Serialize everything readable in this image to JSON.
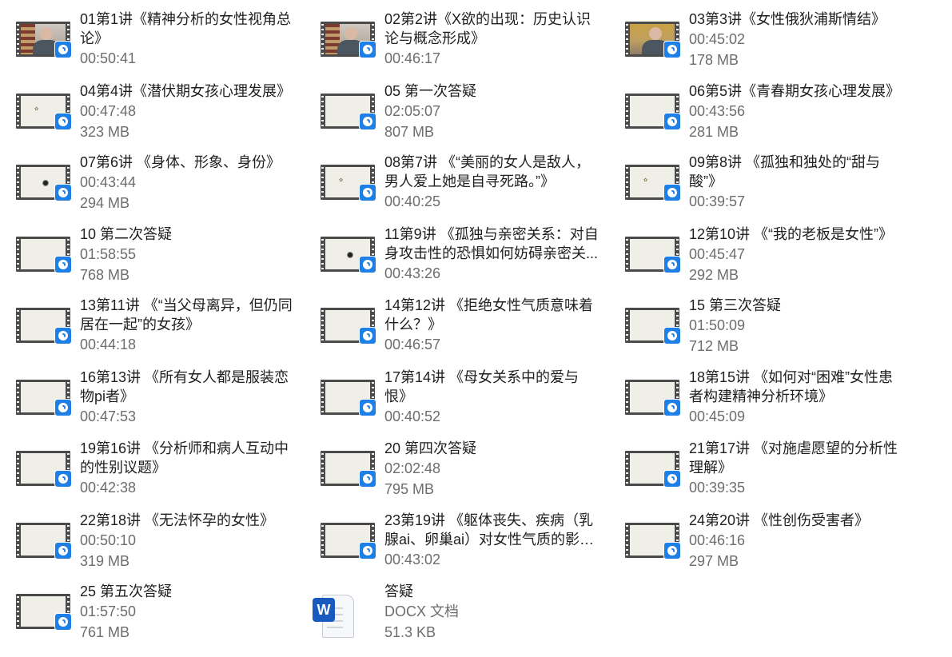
{
  "items": [
    {
      "title": "01第1讲《精神分析的女性视角总论》",
      "duration": "00:50:41",
      "size": "",
      "thumb": "photo-shelf",
      "icon": "video-file-icon"
    },
    {
      "title": "02第2讲《X欲的出现：历史认识论与概念形成》",
      "duration": "00:46:17",
      "size": "",
      "thumb": "photo-shelf",
      "icon": "video-file-icon"
    },
    {
      "title": "03第3讲《女性俄狄浦斯情结》",
      "duration": "00:45:02",
      "size": "178 MB",
      "thumb": "photo-gold",
      "icon": "video-file-icon"
    },
    {
      "title": "04第4讲《潜伏期女孩心理发展》",
      "duration": "00:47:48",
      "size": "323 MB",
      "thumb": "logo",
      "icon": "video-file-icon"
    },
    {
      "title": "05 第一次答疑",
      "duration": "02:05:07",
      "size": "807 MB",
      "thumb": "blank",
      "icon": "video-file-icon"
    },
    {
      "title": "06第5讲《青春期女孩心理发展》",
      "duration": "00:43:56",
      "size": "281 MB",
      "thumb": "blank",
      "icon": "video-file-icon"
    },
    {
      "title": "07第6讲 《身体、形象、身份》",
      "duration": "00:43:44",
      "size": "294 MB",
      "thumb": "dot",
      "icon": "video-file-icon"
    },
    {
      "title": "08第7讲 《“美丽的女人是敌人，男人爱上她是自寻死路。”》",
      "duration": "00:40:25",
      "size": "",
      "thumb": "logo",
      "icon": "video-file-icon"
    },
    {
      "title": "09第8讲 《孤独和独处的“甜与酸”》",
      "duration": "00:39:57",
      "size": "",
      "thumb": "logo",
      "icon": "video-file-icon"
    },
    {
      "title": "10 第二次答疑",
      "duration": "01:58:55",
      "size": "768 MB",
      "thumb": "blank",
      "icon": "video-file-icon"
    },
    {
      "title": "11第9讲 《孤独与亲密关系：对自身攻击性的恐惧如何妨碍亲密关...",
      "duration": "00:43:26",
      "size": "",
      "thumb": "dot",
      "icon": "video-file-icon"
    },
    {
      "title": "12第10讲 《“我的老板是女性”》",
      "duration": "00:45:47",
      "size": "292 MB",
      "thumb": "blank",
      "icon": "video-file-icon"
    },
    {
      "title": "13第11讲 《“当父母离异，但仍同居在一起”的女孩》",
      "duration": "00:44:18",
      "size": "",
      "thumb": "blank",
      "icon": "video-file-icon"
    },
    {
      "title": "14第12讲 《拒绝女性气质意味着什么？》",
      "duration": "00:46:57",
      "size": "",
      "thumb": "blank",
      "icon": "video-file-icon"
    },
    {
      "title": "15 第三次答疑",
      "duration": "01:50:09",
      "size": "712 MB",
      "thumb": "blank",
      "icon": "video-file-icon"
    },
    {
      "title": "16第13讲 《所有女人都是服装恋物pi者》",
      "duration": "00:47:53",
      "size": "",
      "thumb": "blank",
      "icon": "video-file-icon"
    },
    {
      "title": "17第14讲 《母女关系中的爱与恨》",
      "duration": "00:40:52",
      "size": "",
      "thumb": "blank",
      "icon": "video-file-icon"
    },
    {
      "title": "18第15讲 《如何对“困难”女性患者构建精神分析环境》",
      "duration": "00:45:09",
      "size": "",
      "thumb": "blank",
      "icon": "video-file-icon"
    },
    {
      "title": "19第16讲 《分析师和病人互动中的性别议题》",
      "duration": "00:42:38",
      "size": "",
      "thumb": "blank",
      "icon": "video-file-icon"
    },
    {
      "title": "20 第四次答疑",
      "duration": "02:02:48",
      "size": "795 MB",
      "thumb": "blank",
      "icon": "video-file-icon"
    },
    {
      "title": "21第17讲 《对施虐愿望的分析性理解》",
      "duration": "00:39:35",
      "size": "",
      "thumb": "blank",
      "icon": "video-file-icon"
    },
    {
      "title": "22第18讲 《无法怀孕的女性》",
      "duration": "00:50:10",
      "size": "319 MB",
      "thumb": "blank",
      "icon": "video-file-icon"
    },
    {
      "title": "23第19讲 《躯体丧失、疾病（乳腺ai、卵巢ai）对女性气质的影响...",
      "duration": "00:43:02",
      "size": "",
      "thumb": "blank",
      "icon": "video-file-icon"
    },
    {
      "title": "24第20讲 《性创伤受害者》",
      "duration": "00:46:16",
      "size": "297 MB",
      "thumb": "blank",
      "icon": "video-file-icon"
    },
    {
      "title": "25 第五次答疑",
      "duration": "01:57:50",
      "size": "761 MB",
      "thumb": "blank",
      "icon": "video-file-icon"
    },
    {
      "title": "答疑",
      "duration": "DOCX 文档",
      "size": "51.3 KB",
      "thumb": "docx",
      "icon": "word-document-icon",
      "doc_letter": "W"
    }
  ]
}
